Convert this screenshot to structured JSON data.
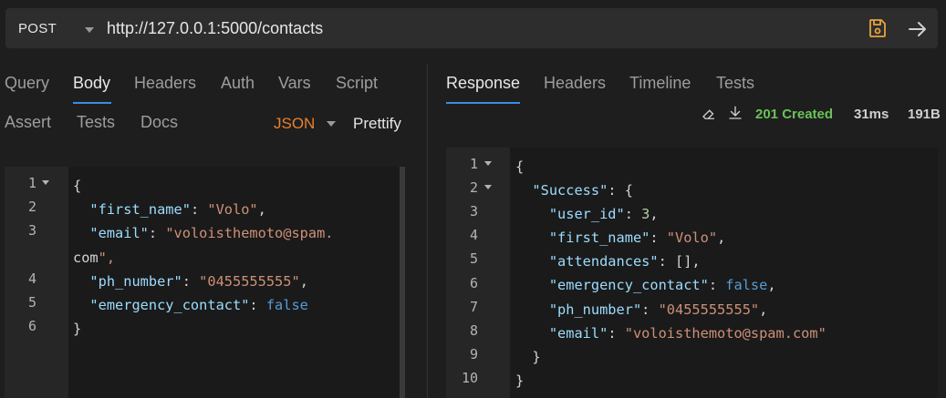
{
  "request": {
    "method": "POST",
    "url": "http://127.0.0.1:5000/contacts"
  },
  "request_tabs": [
    "Query",
    "Body",
    "Headers",
    "Auth",
    "Vars",
    "Script",
    "Assert",
    "Tests",
    "Docs"
  ],
  "body_mode": "JSON",
  "prettify_label": "Prettify",
  "response_tabs": [
    "Response",
    "Headers",
    "Timeline",
    "Tests"
  ],
  "response_meta": {
    "status": "201 Created",
    "time": "31ms",
    "size": "191B"
  },
  "request_body": {
    "line_numbers": [
      "1",
      "2",
      "3",
      "4",
      "5",
      "6"
    ],
    "lines": [
      "{",
      "  \"first_name\": \"Volo\",",
      "  \"email\": \"voloisthemoto@spam.",
      "com\",",
      "  \"ph_number\": \"0455555555\",",
      "  \"emergency_contact\": false",
      "}"
    ]
  },
  "response_body": {
    "line_numbers": [
      "1",
      "2",
      "3",
      "4",
      "5",
      "6",
      "7",
      "8",
      "9",
      "10"
    ],
    "lines": [
      "{",
      "  \"Success\": {",
      "    \"user_id\": 3,",
      "    \"first_name\": \"Volo\",",
      "    \"attendances\": [],",
      "    \"emergency_contact\": false,",
      "    \"ph_number\": \"0455555555\",",
      "    \"email\": \"voloisthemoto@spam.com\"",
      "  }",
      "}"
    ]
  },
  "colors": {
    "accent": "#3b8de0",
    "json_mode": "#e8802f",
    "status_ok": "#6ac259",
    "save_icon": "#e8a33d"
  },
  "icons": [
    "chevron-down-icon",
    "save-icon",
    "arrow-right-icon",
    "eraser-icon",
    "download-icon"
  ]
}
